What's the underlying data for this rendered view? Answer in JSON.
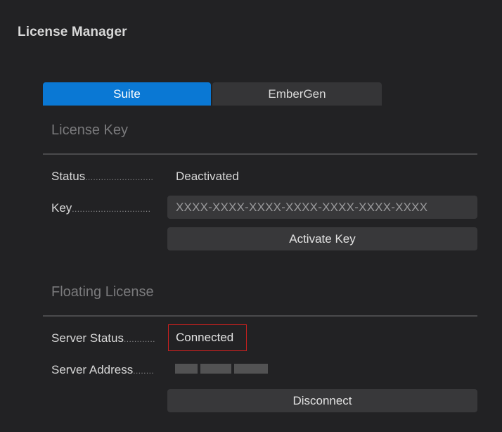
{
  "window": {
    "title": "License Manager"
  },
  "tabs": [
    {
      "label": "Suite",
      "active": true
    },
    {
      "label": "EmberGen",
      "active": false
    }
  ],
  "license_key": {
    "section_title": "License Key",
    "status_label": "Status",
    "status_value": "Deactivated",
    "key_label": "Key",
    "key_placeholder": "XXXX-XXXX-XXXX-XXXX-XXXX-XXXX-XXXX",
    "activate_button": "Activate Key"
  },
  "floating_license": {
    "section_title": "Floating License",
    "server_status_label": "Server Status",
    "server_status_value": "Connected",
    "server_address_label": "Server Address",
    "disconnect_button": "Disconnect"
  },
  "colors": {
    "active_tab": "#0a78d4",
    "highlight_border": "#c8201f"
  },
  "icons": []
}
